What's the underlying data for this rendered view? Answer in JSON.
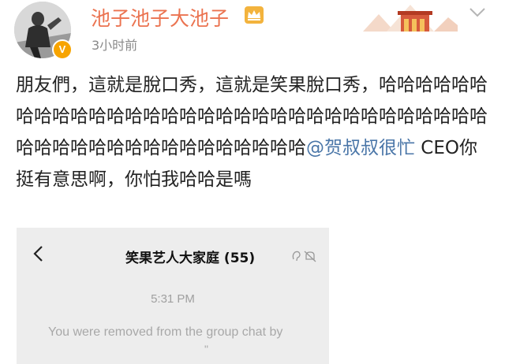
{
  "post": {
    "author": {
      "name": "池子池子大池子",
      "verified_badge_icon": "v-verified-icon",
      "member_crown_icon": "crown-icon"
    },
    "timestamp": "3小时前",
    "text_before_mention": "朋友們，這就是脫口秀，這就是笑果脫口秀，哈哈哈哈哈哈哈哈哈哈哈哈哈哈哈哈哈哈哈哈哈哈哈哈哈哈哈哈哈哈哈哈哈哈哈哈哈哈哈哈哈哈哈哈哈哈哈哈",
    "mention": "@贺叔叔很忙",
    "text_after_mention": " CEO你挺有意思啊，你怕我哈哈是嗎",
    "colors": {
      "username": "#eb7350",
      "mention": "#4a76a8",
      "badge": "#f7a400"
    }
  },
  "embedded_screenshot": {
    "back_icon": "chevron-left-icon",
    "group_name": "笑果艺人大家庭",
    "member_count": "(55)",
    "status_icons": [
      "ear-icon",
      "mute-bell-icon"
    ],
    "message_time": "5:31 PM",
    "system_notice": "You were removed from the group chat by",
    "notice_trailing": "\""
  }
}
